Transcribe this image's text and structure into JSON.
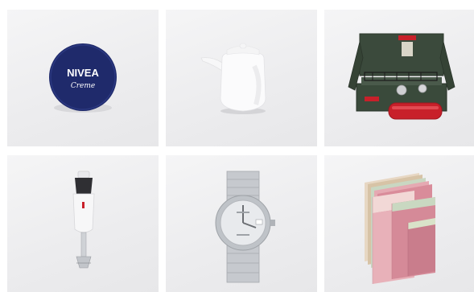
{
  "products": [
    {
      "name": "nivea-creme-tin",
      "icon": "tin-can-icon",
      "brand_text": "NIVEA",
      "sub_text": "Creme",
      "color": "#1f2a6b"
    },
    {
      "name": "white-porcelain-soy-pot",
      "icon": "pot-icon",
      "color": "#ffffff"
    },
    {
      "name": "camping-stove",
      "icon": "stove-icon",
      "color": "#3a4a3b"
    },
    {
      "name": "hand-blender",
      "icon": "blender-icon",
      "color": "#ffffff"
    },
    {
      "name": "wrist-watch",
      "icon": "watch-icon",
      "color": "#c9ccd1"
    },
    {
      "name": "colored-paper-stack",
      "icon": "paper-stack-icon",
      "color": "#d98c9a"
    }
  ],
  "accents": {
    "tile_bg": "#eeeeef",
    "nivea_blue": "#1f2a6b",
    "stove_red": "#c8202a"
  }
}
